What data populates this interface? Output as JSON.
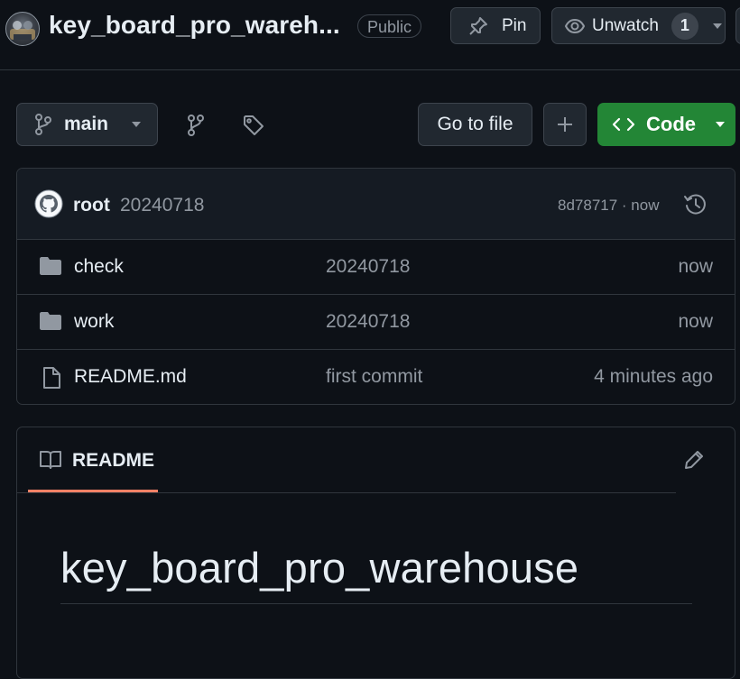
{
  "header": {
    "repo_name": "key_board_pro_wareh...",
    "visibility": "Public",
    "pin_label": "Pin",
    "watch_label": "Unwatch",
    "watch_count": "1"
  },
  "toolbar": {
    "branch": "main",
    "go_to_file": "Go to file",
    "code_label": "Code"
  },
  "latest_commit": {
    "author": "root",
    "message": "20240718",
    "hash_time": "8d78717 · now"
  },
  "files": [
    {
      "type": "folder",
      "name": "check",
      "message": "20240718",
      "time": "now"
    },
    {
      "type": "folder",
      "name": "work",
      "message": "20240718",
      "time": "now"
    },
    {
      "type": "file",
      "name": "README.md",
      "message": "first commit",
      "time": "4 minutes ago"
    }
  ],
  "readme": {
    "tab_label": "README",
    "heading": "key_board_pro_warehouse"
  },
  "colors": {
    "background": "#0d1117",
    "code_button": "#238636",
    "tab_underline": "#f78166",
    "muted_text": "#9198a1"
  },
  "icons": [
    "pin-icon",
    "eye-icon",
    "chevron-down-icon",
    "branch-icon",
    "tag-icon",
    "plus-icon",
    "code-icon",
    "history-icon",
    "folder-icon",
    "file-icon",
    "book-icon",
    "pencil-icon",
    "github-avatar-icon"
  ]
}
